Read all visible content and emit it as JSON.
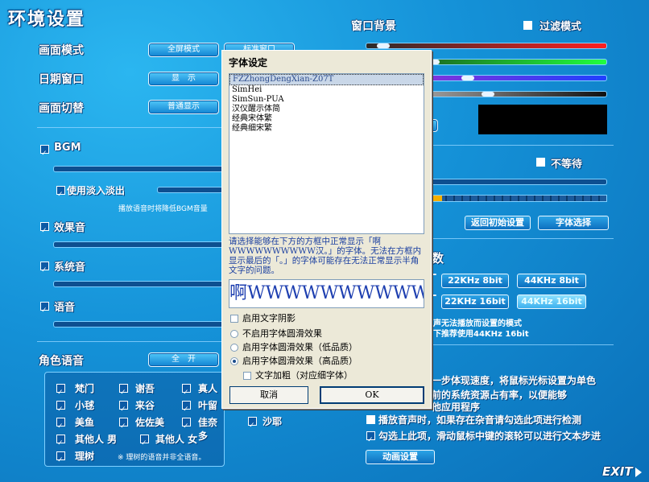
{
  "title": "环境设置",
  "left": {
    "screen_mode": {
      "label": "画面模式",
      "btn1": "全屏模式",
      "btn2": "标准窗口"
    },
    "date_window": {
      "label": "日期窗口",
      "btn": "显　示"
    },
    "screen_switch": {
      "label": "画面切替",
      "btn": "普通显示"
    },
    "bgm": {
      "label": "BGM",
      "fade_label": "使用淡入淡出",
      "note": "播放语音时将降低BGM音量"
    },
    "sfx": {
      "label": "效果音"
    },
    "system_sound": {
      "label": "系统音"
    },
    "voice": {
      "label": "语音"
    },
    "char_voice": {
      "label": "角色语音",
      "btn_all": "全　开"
    },
    "characters": [
      {
        "name": "梵门"
      },
      {
        "name": "谢吾"
      },
      {
        "name": "真人"
      },
      {
        "name": "小毬"
      },
      {
        "name": "来谷"
      },
      {
        "name": "叶留"
      },
      {
        "name": "美鱼"
      },
      {
        "name": "佐佐美"
      },
      {
        "name": "佳奈多"
      },
      {
        "name": "沙耶"
      },
      {
        "name": "其他人 男"
      },
      {
        "name": "其他人 女"
      },
      {
        "name": "理树"
      }
    ],
    "char_note": "※ 理树的语音并非全语音。"
  },
  "right": {
    "window_bg": {
      "label": "窗口背景",
      "filter_label": "过滤模式"
    },
    "no_wait": "不等待",
    "reset_btn": "返回初始设置",
    "font_btn": "字体选择",
    "section_tail": "数",
    "freq_buttons": [
      "22KHz 8bit",
      "44KHz 8bit",
      "22KHz 16bit",
      "44KHz 16bit"
    ],
    "freq_note1": "声无法播放而设置的模式",
    "freq_note2": "下推荐使用44KHz 16bit",
    "perf_note1": "一步体现速度，将鼠标光标设置为单色",
    "perf_note2": "前的系统资源占有率，以便能够",
    "perf_note3": "他应用程序",
    "opt1": "播放音声时，如果存在杂音请勾选此项进行检测",
    "opt2": "勾选上此项，滑动鼠标中键的滚轮可以进行文本步进",
    "anim_btn": "动画设置",
    "exit": "EXIT"
  },
  "dialog": {
    "title": "字体设定",
    "fonts": [
      "FZZhongDengXian-Z07T",
      "SimHei",
      "SimSun-PUA",
      "汉仪醒示体简",
      "经典宋体繁",
      "经典细宋繁"
    ],
    "selected_index": 0,
    "description": "请选择能够在下方的方框中正常显示「啊WWWWWWWWWW汉。」的字体。无法在方框内显示最后的「。」的字体可能存在无法正常显示半角文字的问题。",
    "preview_text": "啊WWWWWWWWWWW",
    "shadow_label": "启用文字阴影",
    "aa_off": "不启用字体圆滑效果",
    "aa_low": "启用字体圆滑效果（低品质）",
    "aa_high": "启用字体圆滑效果（高品质）",
    "bold_label": "文字加粗（对应细字体）",
    "cancel": "取消",
    "ok": "OK"
  }
}
